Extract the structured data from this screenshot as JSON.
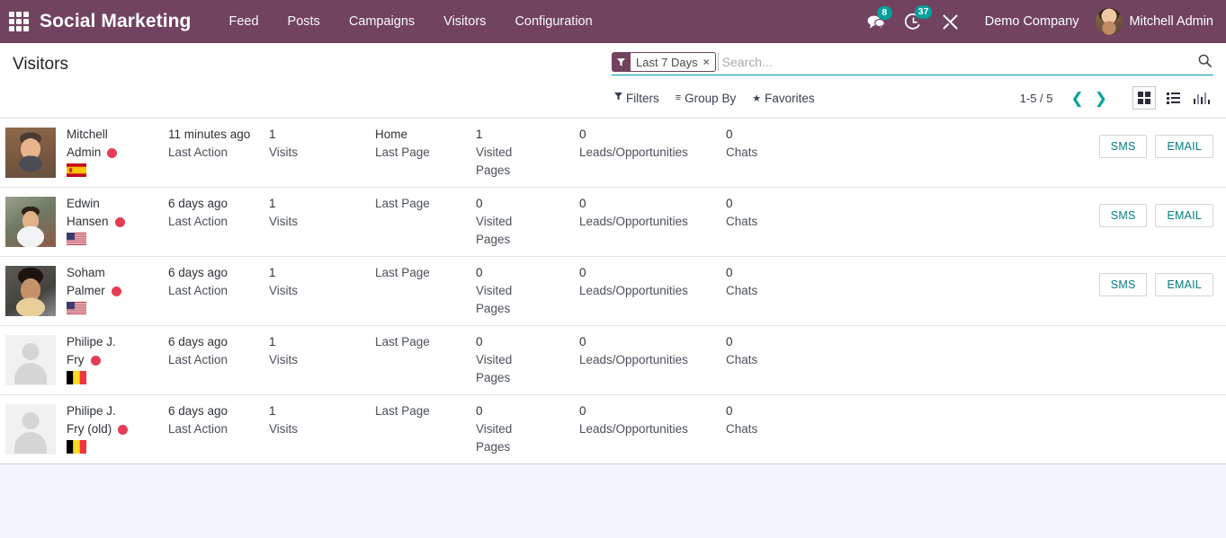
{
  "navbar": {
    "apps_icon": "apps-grid-icon",
    "brand": "Social Marketing",
    "menu": [
      {
        "label": "Feed"
      },
      {
        "label": "Posts"
      },
      {
        "label": "Campaigns"
      },
      {
        "label": "Visitors"
      },
      {
        "label": "Configuration"
      }
    ],
    "messages_icon": "messages-icon",
    "messages_count": "8",
    "activity_icon": "activity-clock-icon",
    "activity_count": "37",
    "debug_icon": "wrench-tools-icon",
    "company": "Demo Company",
    "user_name": "Mitchell Admin",
    "accent_color": "#71435f",
    "badge_color": "#00a09d"
  },
  "control_panel": {
    "title": "Visitors",
    "facet": {
      "icon": "filter-funnel-icon",
      "label": "Last 7 Days",
      "remove": "×"
    },
    "search_placeholder": "Search...",
    "search_value": "",
    "search_icon": "search-icon",
    "filters_label": "Filters",
    "group_by_label": "Group By",
    "favorites_label": "Favorites",
    "pager": "1-5 / 5",
    "prev_icon": "chevron-left-icon",
    "next_icon": "chevron-right-icon",
    "views": [
      {
        "name": "kanban",
        "icon": "kanban-view-icon",
        "active": true
      },
      {
        "name": "list",
        "icon": "list-view-icon",
        "active": false
      },
      {
        "name": "graph",
        "icon": "graph-view-icon",
        "active": false
      }
    ]
  },
  "labels": {
    "last_action": "Last Action",
    "visits": "Visits",
    "last_page": "Last Page",
    "visited_pages": "Visited Pages",
    "visited_pages_l1": "Visited",
    "visited_pages_l2": "Pages",
    "leads": "Leads/Opportunities",
    "chats": "Chats",
    "sms": "SMS",
    "email": "EMAIL"
  },
  "records": [
    {
      "avatar": "photo-avatar-mitchell",
      "name_l1": "Mitchell",
      "name_l2": "Admin",
      "status": "offline-red-dot",
      "flag": "flag-spain",
      "last_action_value": "11 minutes ago",
      "visits_value": "1",
      "last_page_value": "Home",
      "visited_pages_value": "1",
      "leads_value": "0",
      "chats_value": "0",
      "has_actions": true
    },
    {
      "avatar": "photo-avatar-edwin",
      "name_l1": "Edwin",
      "name_l2": "Hansen",
      "status": "offline-red-dot",
      "flag": "flag-usa",
      "last_action_value": "6 days ago",
      "visits_value": "1",
      "last_page_value": "",
      "visited_pages_value": "0",
      "leads_value": "0",
      "chats_value": "0",
      "has_actions": true
    },
    {
      "avatar": "photo-avatar-soham",
      "name_l1": "Soham",
      "name_l2": "Palmer",
      "status": "offline-red-dot",
      "flag": "flag-usa",
      "last_action_value": "6 days ago",
      "visits_value": "1",
      "last_page_value": "",
      "visited_pages_value": "0",
      "leads_value": "0",
      "chats_value": "0",
      "has_actions": true
    },
    {
      "avatar": "placeholder-avatar",
      "name_l1": "Philipe J.",
      "name_l2": "Fry",
      "status": "offline-red-dot",
      "flag": "flag-belgium",
      "last_action_value": "6 days ago",
      "visits_value": "1",
      "last_page_value": "",
      "visited_pages_value": "0",
      "leads_value": "0",
      "chats_value": "0",
      "has_actions": false
    },
    {
      "avatar": "placeholder-avatar",
      "name_l1": "Philipe J.",
      "name_l2": "Fry (old)",
      "status": "offline-red-dot",
      "flag": "flag-belgium",
      "last_action_value": "6 days ago",
      "visits_value": "1",
      "last_page_value": "",
      "visited_pages_value": "0",
      "leads_value": "0",
      "chats_value": "0",
      "has_actions": false
    }
  ]
}
